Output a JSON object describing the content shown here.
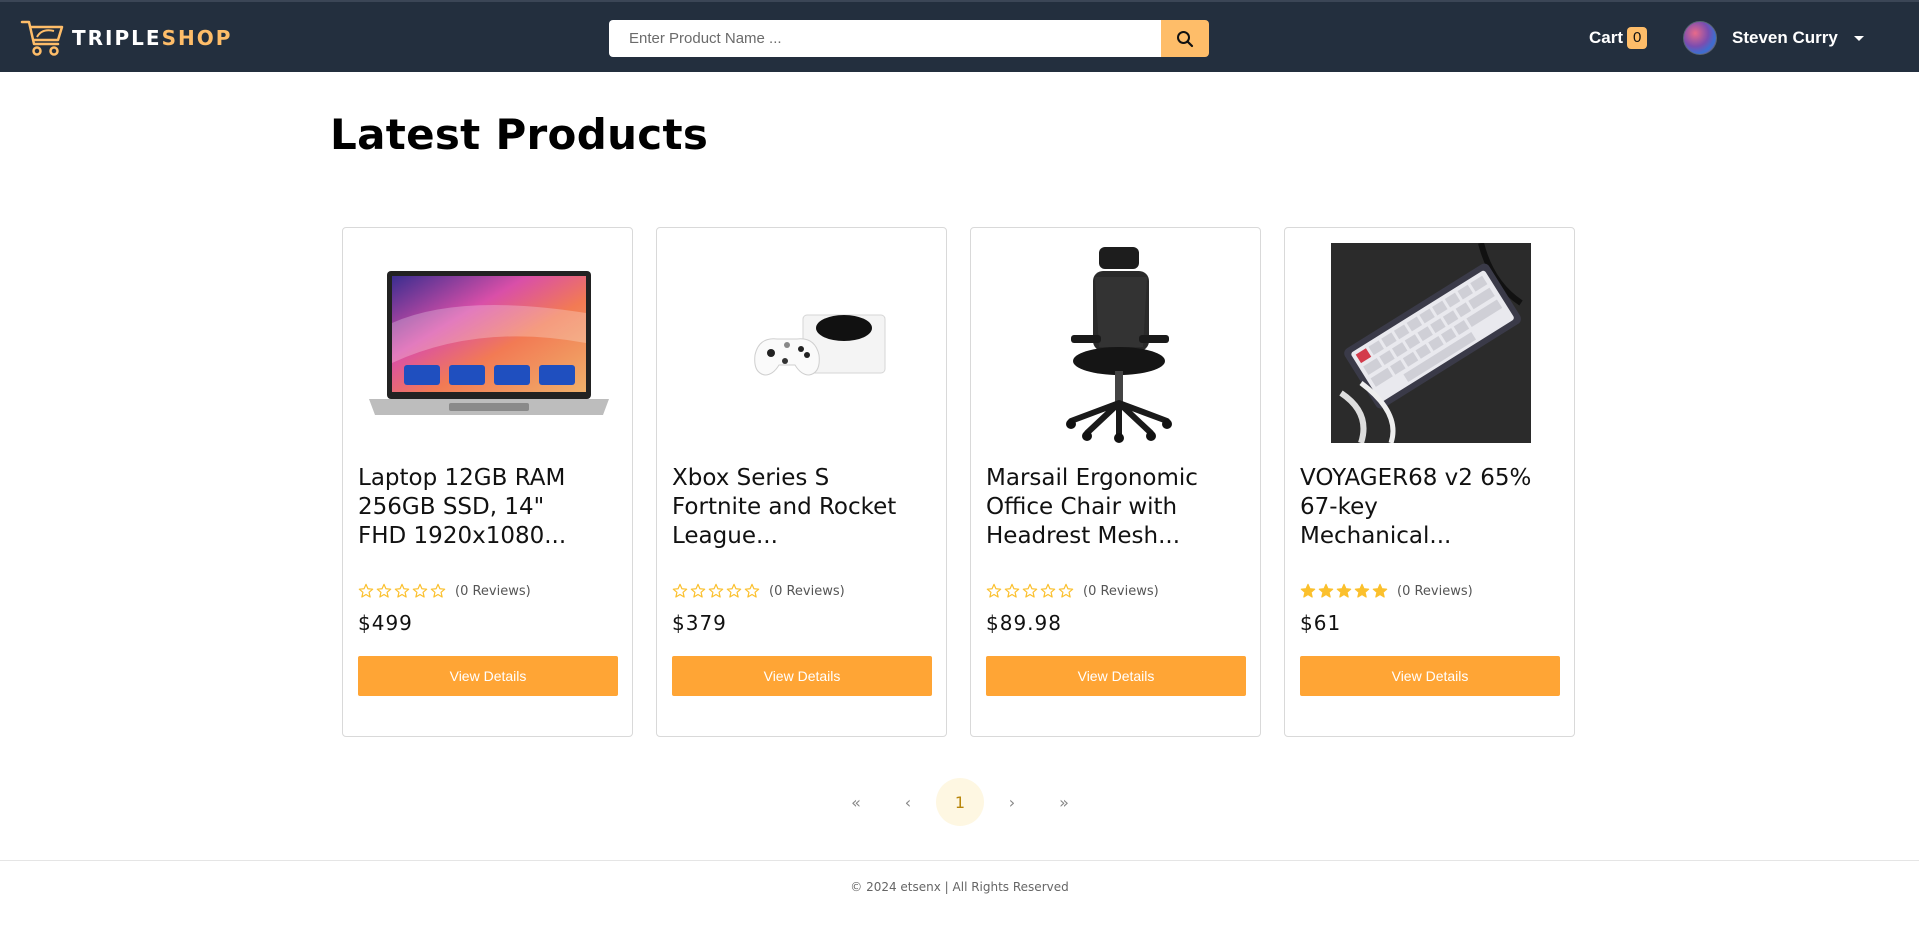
{
  "brand": {
    "name_part1": "TRIPLE",
    "name_part2": "SHOP",
    "accent_color": "#febd69",
    "header_bg": "#232f3e"
  },
  "search": {
    "placeholder": "Enter Product Name ...",
    "value": "",
    "icon": "search-icon"
  },
  "cart": {
    "label": "Cart",
    "count": "0"
  },
  "user": {
    "name": "Steven Curry"
  },
  "main": {
    "title": "Latest Products"
  },
  "products": [
    {
      "title": "Laptop 12GB RAM 256GB SSD, 14\" FHD 1920x1080...",
      "rating": 0,
      "reviews": "(0 Reviews)",
      "price": "$499",
      "button": "View Details",
      "image": "laptop-image"
    },
    {
      "title": "Xbox Series S Fortnite and Rocket League...",
      "rating": 0,
      "reviews": "(0 Reviews)",
      "price": "$379",
      "button": "View Details",
      "image": "xbox-image"
    },
    {
      "title": "Marsail Ergonomic Office Chair with Headrest Mesh...",
      "rating": 0,
      "reviews": "(0 Reviews)",
      "price": "$89.98",
      "button": "View Details",
      "image": "office-chair-image"
    },
    {
      "title": "VOYAGER68 v2 65% 67-key Mechanical...",
      "rating": 5,
      "reviews": "(0 Reviews)",
      "price": "$61",
      "button": "View Details",
      "image": "keyboard-image"
    }
  ],
  "pagination": {
    "first": "«",
    "prev": "‹",
    "current": "1",
    "next": "›",
    "last": "»"
  },
  "footer": {
    "text": "© 2024 etsenx | All Rights Reserved"
  },
  "colors": {
    "button": "#ffa535",
    "star": "#fbc02d"
  }
}
